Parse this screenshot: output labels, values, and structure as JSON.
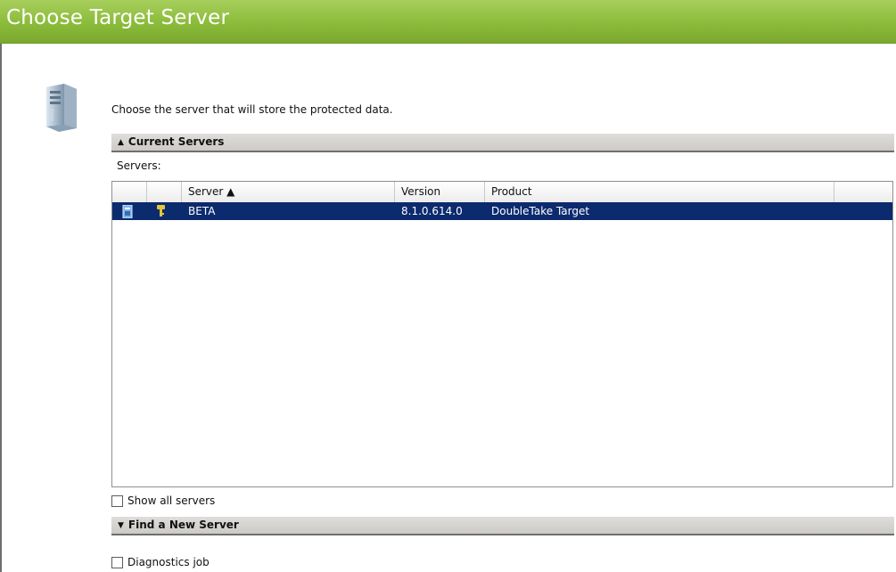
{
  "header": {
    "title": "Choose Target Server"
  },
  "description": "Choose the server that will store the protected data.",
  "sections": {
    "current": {
      "label": "Current Servers",
      "arrow": "▲",
      "expanded": true
    },
    "find": {
      "label": "Find a New Server",
      "arrow": "▼",
      "expanded": false
    }
  },
  "servers_label": "Servers:",
  "grid": {
    "columns": {
      "server": "Server ▲",
      "version": "Version",
      "product": "Product"
    },
    "rows": [
      {
        "server": "BETA",
        "version": "8.1.0.614.0",
        "product": "DoubleTake Target",
        "selected": true,
        "icons": [
          "server-status-icon",
          "key-icon"
        ]
      }
    ]
  },
  "show_all_servers": {
    "label": "Show all servers",
    "checked": false
  },
  "diagnostics_job": {
    "label": "Diagnostics job",
    "checked": false
  },
  "colors": {
    "header_green": "#8bbb3a",
    "selection_blue": "#0c2a6e"
  }
}
